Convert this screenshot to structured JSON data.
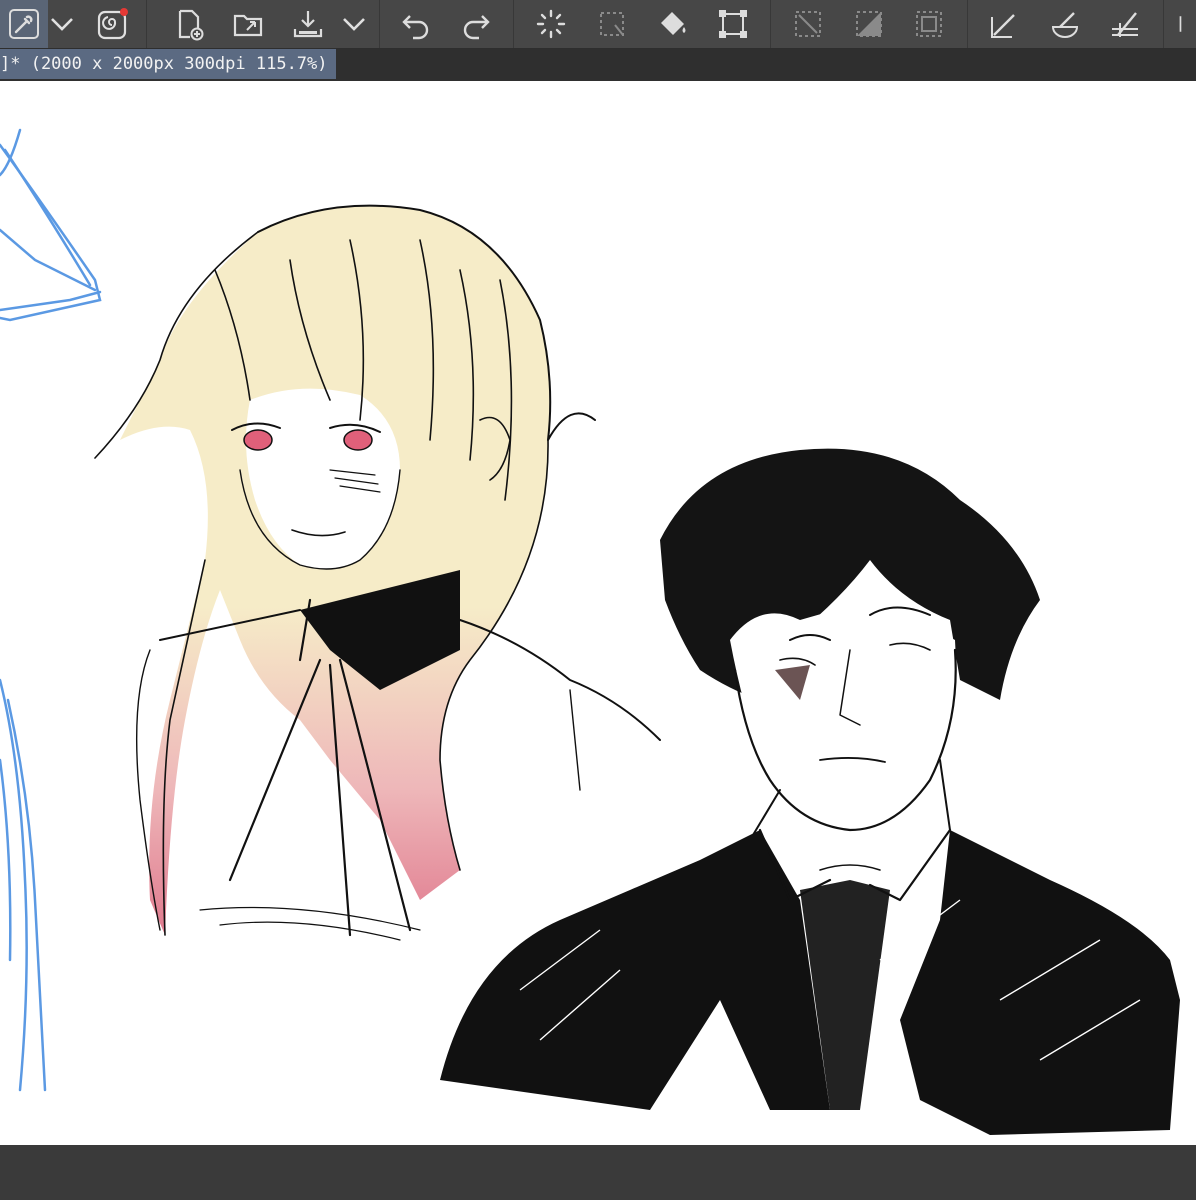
{
  "document": {
    "tab_title": "]* (2000 x 2000px 300dpi 115.7%)"
  },
  "toolbar": {
    "items": [
      {
        "name": "eyedropper-tool-icon",
        "state": "active"
      },
      {
        "name": "chevron-down-icon"
      },
      {
        "name": "spiral-app-icon",
        "badge": "#e53935"
      },
      {
        "name": "new-canvas-icon"
      },
      {
        "name": "open-folder-icon"
      },
      {
        "name": "save-download-icon"
      },
      {
        "name": "chevron-down-icon"
      },
      {
        "name": "undo-icon"
      },
      {
        "name": "redo-icon"
      },
      {
        "name": "loading-spinner-icon"
      },
      {
        "name": "deselect-icon",
        "state": "disabled"
      },
      {
        "name": "fill-bucket-icon"
      },
      {
        "name": "transform-icon"
      },
      {
        "name": "clear-selection-icon",
        "state": "disabled"
      },
      {
        "name": "fill-selection-icon",
        "state": "disabled"
      },
      {
        "name": "crop-selection-icon",
        "state": "disabled"
      },
      {
        "name": "ruler-snap-icon"
      },
      {
        "name": "brush-blend-icon"
      },
      {
        "name": "perspective-ruler-icon"
      },
      {
        "name": "more-icon"
      }
    ]
  },
  "colors": {
    "toolbar_bg": "#474747",
    "tab_active": "#5b6a82",
    "canvas": "#ffffff",
    "hair_blonde": "#f6ecc8",
    "hair_pink": "#e07a8e",
    "eyes": "#e0607a",
    "sketch_blue": "#4a8fe0"
  }
}
